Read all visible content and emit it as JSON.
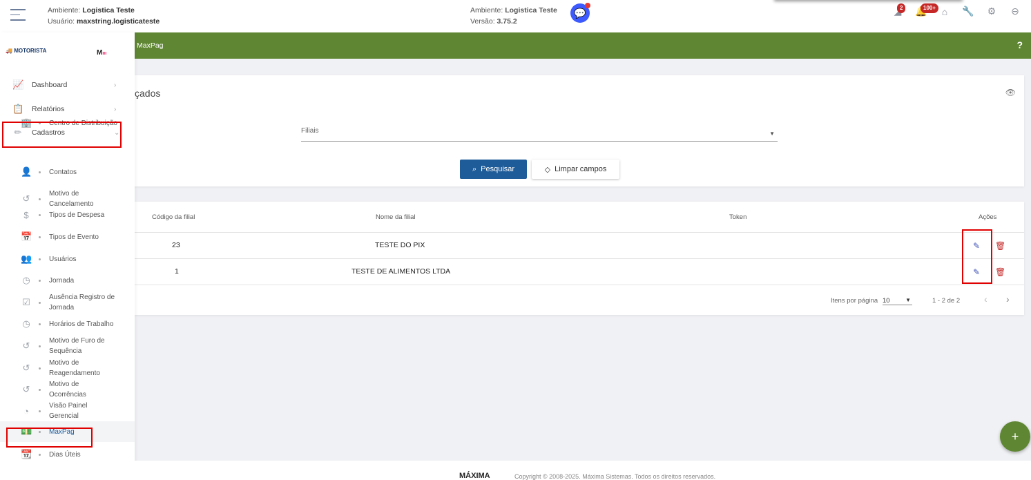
{
  "header": {
    "env_label": "Ambiente:",
    "env_value": "Logistica Teste",
    "user_label": "Usuário:",
    "user_value": "maxstring.logisticateste",
    "env2_label": "Ambiente:",
    "env2_value": "Logistica Teste",
    "version_label": "Versão:",
    "version_value": "3.75.2",
    "badge_alerts": "2",
    "badge_notifications": "100+"
  },
  "topbar": {
    "title": "MaxPag",
    "help": "?"
  },
  "sidebar": {
    "logo": "MOTORISTA",
    "logo_small": "max",
    "mlogo": "M",
    "items": [
      {
        "label": "Dashboard"
      },
      {
        "label": "Relatórios"
      },
      {
        "label": "Cadastros"
      }
    ],
    "sub": [
      "Centro de Distribuição",
      "Contatos",
      "Motivo de Cancelamento",
      "Tipos de Despesa",
      "Tipos de Evento",
      "Usuários",
      "Jornada",
      "Ausência Registro de Jornada",
      "Horários de Trabalho",
      "Motivo de Furo de Sequência",
      "Motivo de Reagendamento",
      "Motivo de Ocorrências",
      "Visão Painel Gerencial",
      "MaxPag",
      "Dias Úteis"
    ]
  },
  "filter": {
    "title": "çados",
    "select_placeholder": "Filiais",
    "search": "Pesquisar",
    "clear": "Limpar campos"
  },
  "table": {
    "headers": [
      "Código da filial",
      "Nome da filial",
      "Token",
      "Ações"
    ],
    "rows": [
      {
        "code": "23",
        "name": "TESTE DO PIX",
        "token": ""
      },
      {
        "code": "1",
        "name": "TESTE DE ALIMENTOS LTDA",
        "token": ""
      }
    ],
    "items_per_page_label": "Itens por página",
    "items_per_page": "10",
    "range": "1 - 2 de 2"
  },
  "footer": {
    "logo": "MÁXIMA",
    "copyright": "Copyright © 2008-2025. Máxima Sistemas. Todos os direitos reservados."
  },
  "fab": "+"
}
